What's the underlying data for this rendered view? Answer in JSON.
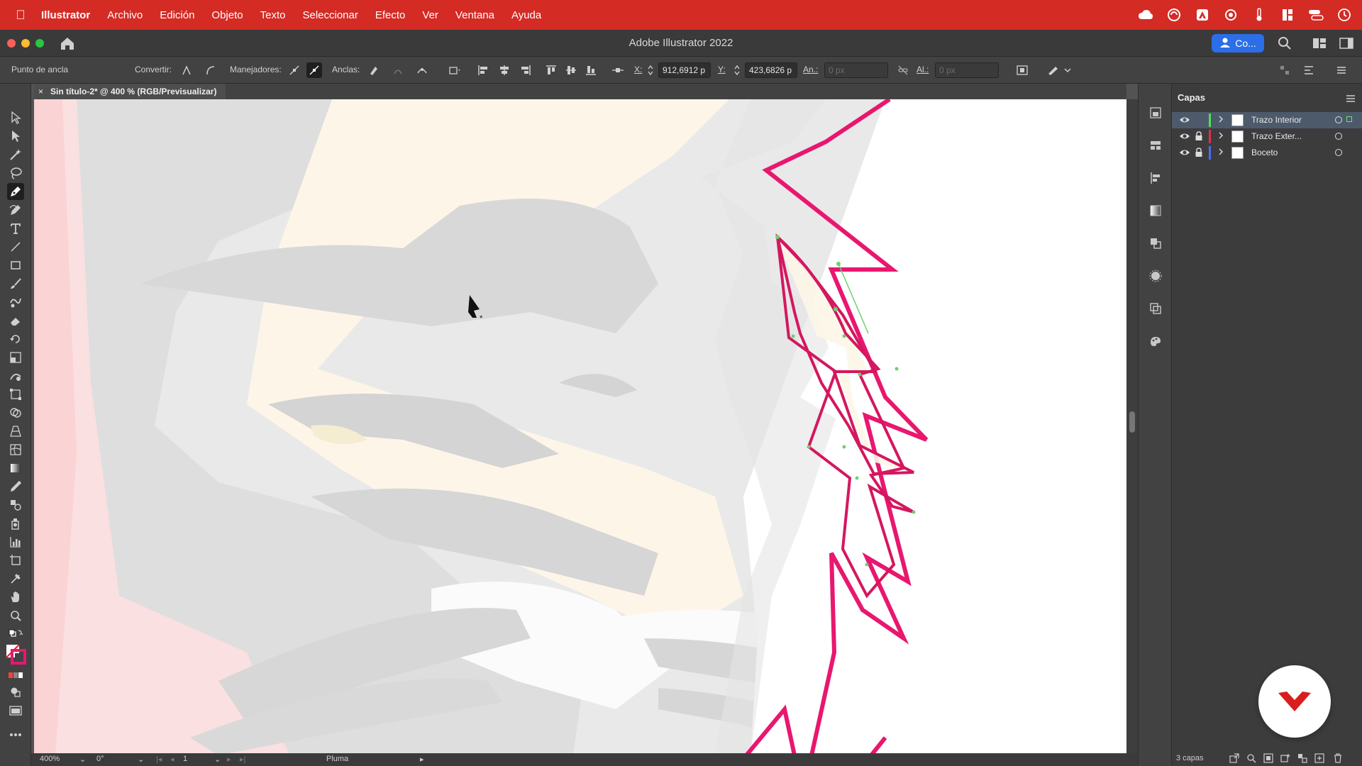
{
  "menubar": {
    "app_name": "Illustrator",
    "items": [
      "Archivo",
      "Edición",
      "Objeto",
      "Texto",
      "Seleccionar",
      "Efecto",
      "Ver",
      "Ventana",
      "Ayuda"
    ]
  },
  "titlebar": {
    "title": "Adobe Illustrator 2022",
    "share_label": "Co..."
  },
  "controlbar": {
    "mode_label": "Punto de ancla",
    "convert_label": "Convertir:",
    "handles_label": "Manejadores:",
    "anchors_label": "Anclas:",
    "x_label": "X:",
    "x_value": "912,6912 p",
    "y_label": "Y:",
    "y_value": "423,6826 p",
    "w_label": "An.:",
    "w_value": "0 px",
    "h_label": "Al.:",
    "h_value": "0 px"
  },
  "document_tab": {
    "close": "×",
    "title": "Sin título-2* @ 400 % (RGB/Previsualizar)"
  },
  "statusbar": {
    "zoom": "400%",
    "rotation": "0°",
    "artboard": "1",
    "tool": "Pluma"
  },
  "layers_panel": {
    "title": "Capas",
    "layers": [
      {
        "name": "Trazo Interior",
        "color": "#4fe04f",
        "locked": false,
        "selected": true
      },
      {
        "name": "Trazo Exter...",
        "color": "#e0304a",
        "locked": true,
        "selected": false
      },
      {
        "name": "Boceto",
        "color": "#4a6cf0",
        "locked": true,
        "selected": false
      }
    ],
    "count": "3 capas"
  },
  "colors": {
    "menubar": "#d42b25",
    "outer_stroke": "#e8176f",
    "inner_stroke": "#d4175f",
    "anchor": "#6fd06f"
  }
}
